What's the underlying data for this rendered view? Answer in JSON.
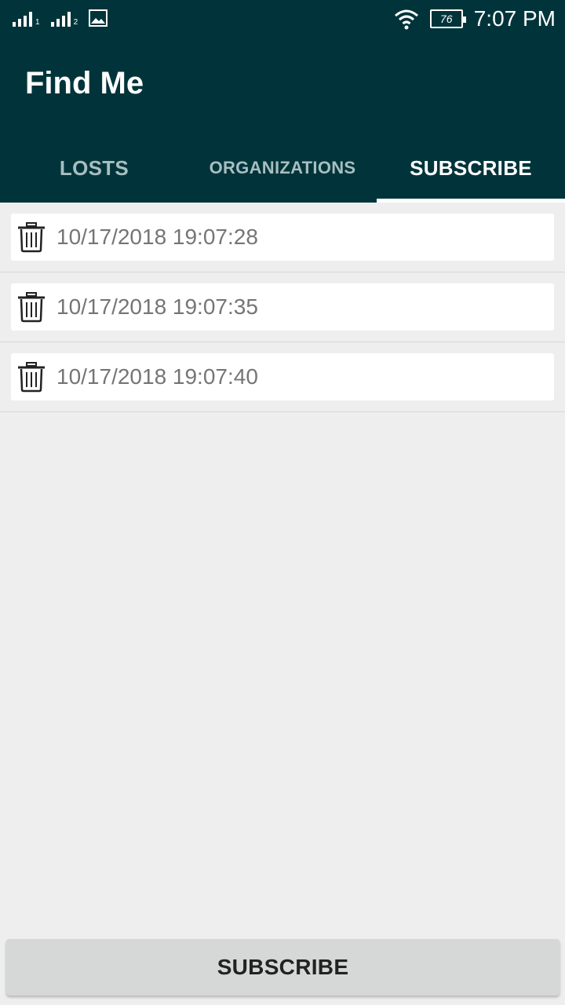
{
  "status_bar": {
    "sim1_label": "1",
    "sim2_label": "2",
    "battery": "76",
    "time": "7:07 PM"
  },
  "app": {
    "title": "Find Me"
  },
  "tabs": [
    {
      "label": "LOSTS",
      "active": false
    },
    {
      "label": "ORGANIZATIONS",
      "active": false
    },
    {
      "label": "SUBSCRIBE",
      "active": true
    }
  ],
  "subscriptions": [
    {
      "timestamp": "10/17/2018 19:07:28",
      "icon": "trash-icon"
    },
    {
      "timestamp": "10/17/2018 19:07:35",
      "icon": "trash-icon"
    },
    {
      "timestamp": "10/17/2018 19:07:40",
      "icon": "trash-icon"
    }
  ],
  "subscribe_button": {
    "label": "SUBSCRIBE"
  },
  "colors": {
    "app_bar": "#00343a",
    "background": "#eeeeee",
    "button": "#d6d7d7"
  }
}
